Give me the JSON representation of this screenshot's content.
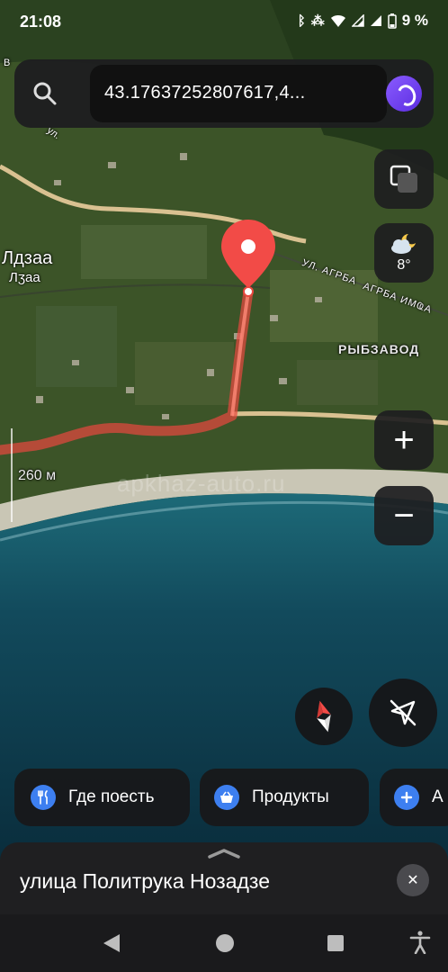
{
  "status": {
    "time": "21:08",
    "battery": "9 %",
    "icons": [
      "bluetooth-icon",
      "vibrate-icon",
      "wifi-icon",
      "signal-icon",
      "signal-icon",
      "battery-icon"
    ]
  },
  "search": {
    "value": "43.17637252807617,4..."
  },
  "map": {
    "labels": {
      "ldzaa": "Лдзаа",
      "ldzaa_abkhaz": "Лӡаа",
      "street_agrba": "УЛ. АГРБА",
      "street_agrba_abkh": "АГРБА ИМҨА",
      "rybzavod": "РЫБЗАВОД",
      "ul": "ул.",
      "v": "В"
    },
    "scale": "260 м",
    "watermark": "apkhaz-auto.ru"
  },
  "weather": {
    "temp": "8°",
    "icon": "partly-cloudy-night-icon"
  },
  "controls": {
    "zoom_in": "+",
    "zoom_out": "−"
  },
  "chips": {
    "food": "Где поесть",
    "grocery": "Продукты",
    "more": "А"
  },
  "card": {
    "title": "улица Политрука Нозадзе",
    "close": "✕"
  },
  "colors": {
    "pin": "#f24b47",
    "route": "#e8473f",
    "accent": "#3d7ff0",
    "alice": "#7a46f5"
  }
}
